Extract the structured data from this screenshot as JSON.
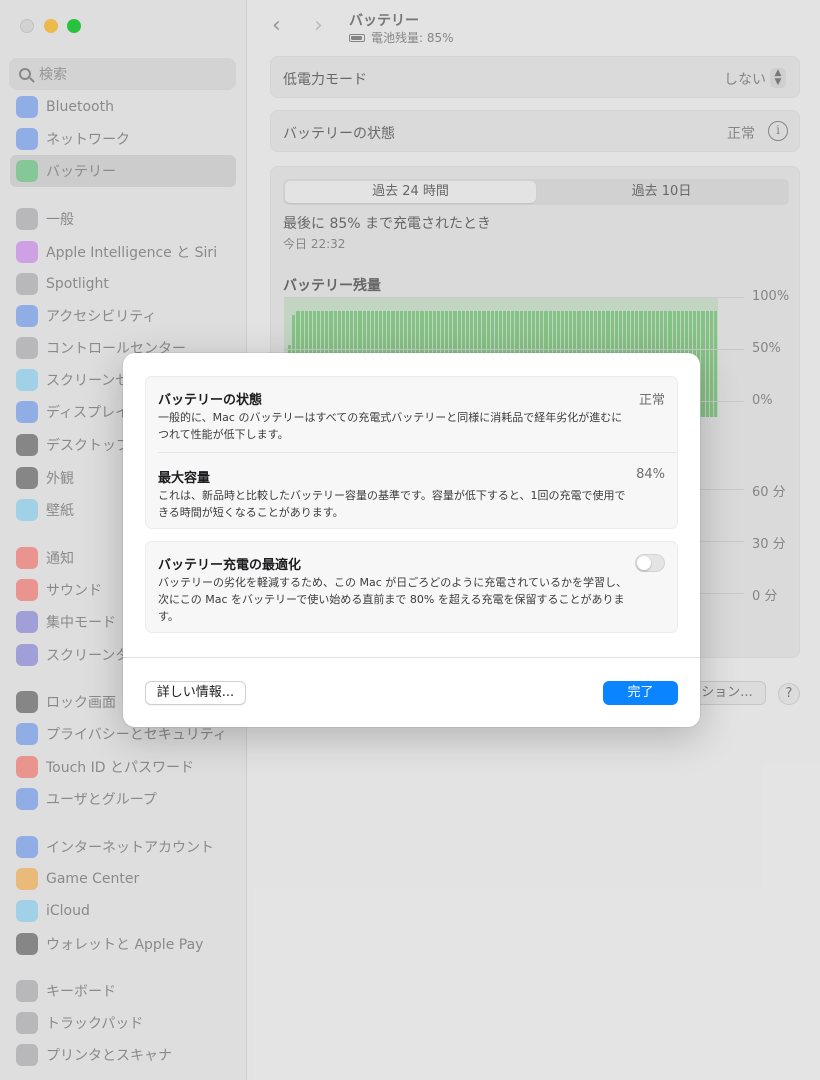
{
  "window": {
    "title": "バッテリー",
    "subtitle": "電池残量: 85%"
  },
  "search": {
    "placeholder": "検索"
  },
  "sidebar": {
    "items": [
      {
        "label": "Bluetooth",
        "icon": "bluetooth-icon",
        "color": "#3478f6"
      },
      {
        "label": "ネットワーク",
        "icon": "globe-icon",
        "color": "#3478f6"
      },
      {
        "label": "バッテリー",
        "icon": "battery-icon",
        "color": "#34c759",
        "selected": true
      },
      {
        "label": "一般",
        "icon": "gear-icon",
        "color": "#8e8e93"
      },
      {
        "label": "Apple Intelligence と Siri",
        "icon": "siri-icon",
        "color": "#bf5af2"
      },
      {
        "label": "Spotlight",
        "icon": "magnifier-icon",
        "color": "#8e8e93"
      },
      {
        "label": "アクセシビリティ",
        "icon": "accessibility-icon",
        "color": "#3478f6"
      },
      {
        "label": "コントロールセンター",
        "icon": "control-center-icon",
        "color": "#8e8e93"
      },
      {
        "label": "スクリーンセーバ",
        "icon": "screensaver-icon",
        "color": "#5ac8fa"
      },
      {
        "label": "ディスプレイ",
        "icon": "sun-icon",
        "color": "#3478f6"
      },
      {
        "label": "デスクトップとDock",
        "icon": "dock-icon",
        "color": "#1d1d1f"
      },
      {
        "label": "外観",
        "icon": "appearance-icon",
        "color": "#1d1d1f"
      },
      {
        "label": "壁紙",
        "icon": "wallpaper-icon",
        "color": "#5ac8fa"
      },
      {
        "label": "通知",
        "icon": "bell-icon",
        "color": "#ff3b30"
      },
      {
        "label": "サウンド",
        "icon": "speaker-icon",
        "color": "#ff3b30"
      },
      {
        "label": "集中モード",
        "icon": "moon-icon",
        "color": "#5856d6"
      },
      {
        "label": "スクリーンタイム",
        "icon": "hourglass-icon",
        "color": "#5856d6"
      },
      {
        "label": "ロック画面",
        "icon": "lock-icon",
        "color": "#1d1d1f"
      },
      {
        "label": "プライバシーとセキュリティ",
        "icon": "hand-icon",
        "color": "#3478f6"
      },
      {
        "label": "Touch ID とパスワード",
        "icon": "fingerprint-icon",
        "color": "#ff3b30"
      },
      {
        "label": "ユーザとグループ",
        "icon": "users-icon",
        "color": "#3478f6"
      },
      {
        "label": "インターネットアカウント",
        "icon": "at-icon",
        "color": "#3478f6"
      },
      {
        "label": "Game Center",
        "icon": "game-center-icon",
        "color": "#ff9500"
      },
      {
        "label": "iCloud",
        "icon": "cloud-icon",
        "color": "#5ac8fa"
      },
      {
        "label": "ウォレットと Apple Pay",
        "icon": "wallet-icon",
        "color": "#1d1d1f"
      },
      {
        "label": "キーボード",
        "icon": "keyboard-icon",
        "color": "#8e8e93"
      },
      {
        "label": "トラックパッド",
        "icon": "trackpad-icon",
        "color": "#8e8e93"
      },
      {
        "label": "プリンタとスキャナ",
        "icon": "printer-icon",
        "color": "#8e8e93"
      }
    ]
  },
  "main": {
    "low_power": {
      "label": "低電力モード",
      "value": "しない"
    },
    "battery_health": {
      "label": "バッテリーの状態",
      "value": "正常"
    },
    "tabs": [
      {
        "label": "過去 24 時間",
        "active": true
      },
      {
        "label": "過去 10日",
        "active": false
      }
    ],
    "last_charged": {
      "label": "最後に 85% まで充電されたとき",
      "time": "今日 22:32"
    },
    "chart_title": "バッテリー残量",
    "buttons": {
      "options_partial": "ション...",
      "help": "?"
    }
  },
  "chart_data": [
    {
      "type": "bar",
      "title": "バッテリー残量",
      "yticks": [
        "100%",
        "50%",
        "0%"
      ],
      "ylim": [
        0,
        100
      ],
      "values": [
        30,
        60,
        85,
        88,
        88,
        88,
        88,
        88,
        88,
        88,
        88,
        88,
        88,
        88,
        88,
        88,
        88,
        88,
        88,
        88,
        88,
        88,
        88,
        88,
        88,
        88,
        88,
        88,
        88,
        88,
        88,
        88,
        88,
        88,
        88,
        88,
        88,
        88,
        88,
        88,
        88,
        88,
        88,
        88,
        88,
        88,
        88,
        88,
        88,
        88,
        88,
        88,
        88,
        88,
        88,
        88,
        88,
        88,
        88,
        88,
        88,
        88,
        88,
        88,
        88,
        88,
        88,
        88,
        88,
        88,
        88,
        88,
        88,
        88,
        88,
        88,
        88,
        88,
        88,
        88,
        88,
        88,
        88,
        88,
        88,
        88,
        88,
        88,
        88,
        88,
        88,
        88,
        88,
        88,
        88,
        88,
        88,
        88,
        88,
        88,
        88,
        88,
        88,
        88,
        88
      ]
    },
    {
      "type": "bar",
      "yticks": [
        "60 分",
        "30 分",
        "0 分"
      ],
      "values": []
    }
  ],
  "dialog": {
    "health": {
      "title": "バッテリーの状態",
      "value": "正常",
      "desc": "一般的に、Mac のバッテリーはすべての充電式バッテリーと同様に消耗品で経年劣化が進むにつれて性能が低下します。"
    },
    "capacity": {
      "title": "最大容量",
      "value": "84%",
      "desc": "これは、新品時と比較したバッテリー容量の基準です。容量が低下すると、1回の充電で使用できる時間が短くなることがあります。"
    },
    "optimize": {
      "title": "バッテリー充電の最適化",
      "enabled": false,
      "desc": "バッテリーの劣化を軽減するため、この Mac が日ごろどのように充電されているかを学習し、次にこの Mac をバッテリーで使い始める直前まで 80% を超える充電を保留することがあります。"
    },
    "more_button": "詳しい情報...",
    "done_button": "完了",
    "accent": "#0a84ff"
  }
}
